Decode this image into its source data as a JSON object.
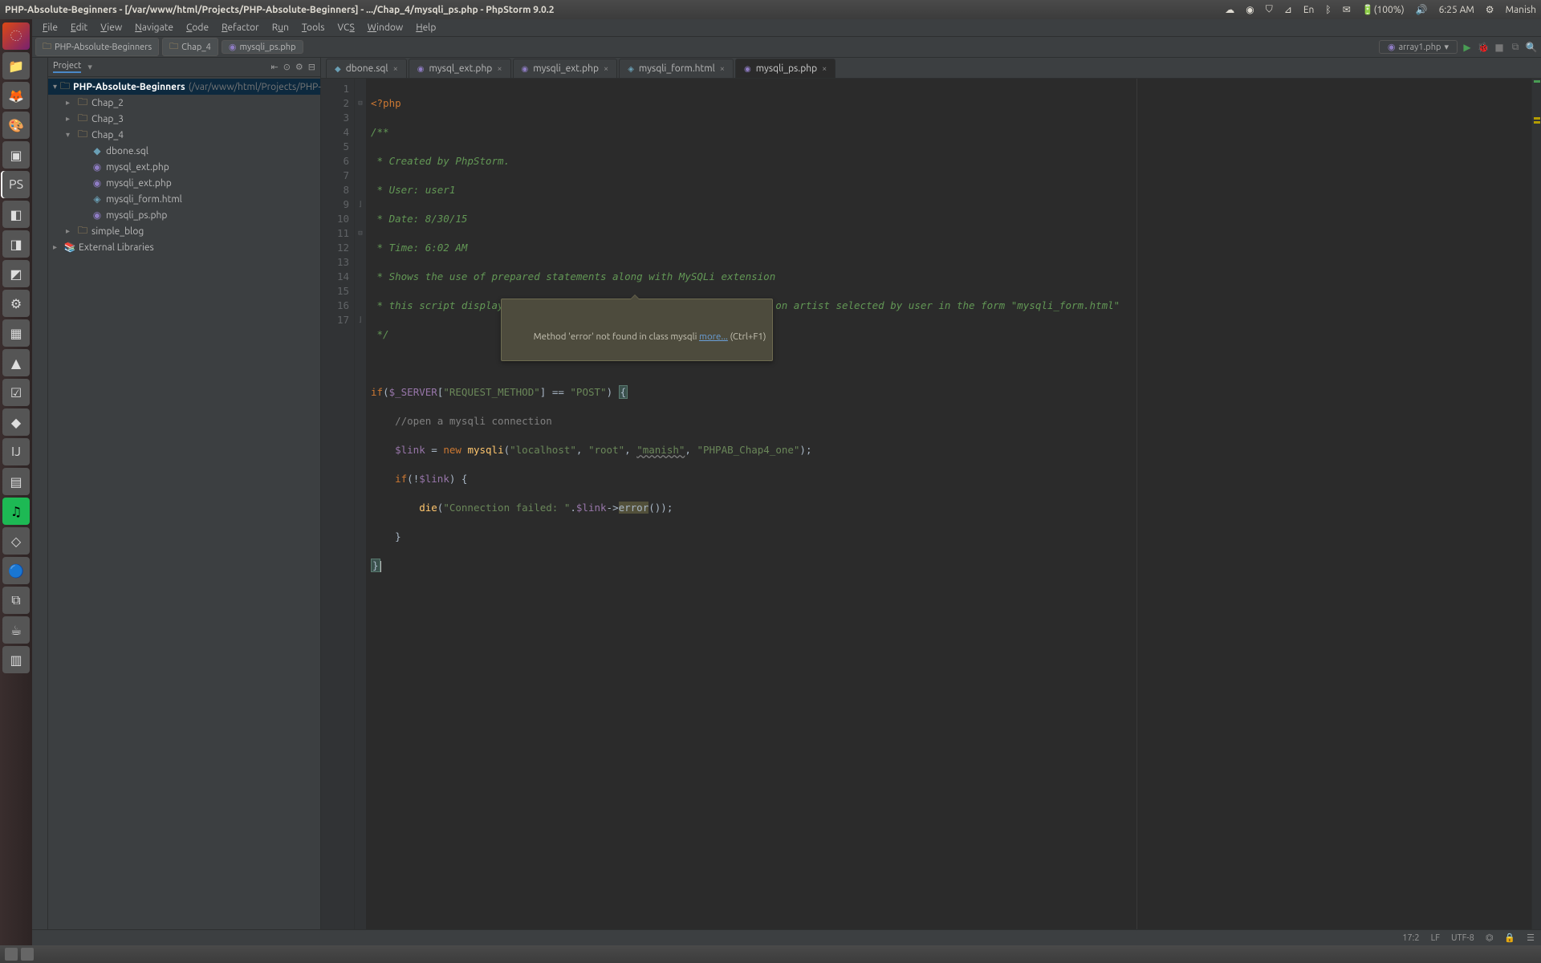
{
  "window_title": "PHP-Absolute-Beginners - [/var/www/html/Projects/PHP-Absolute-Beginners] - .../Chap_4/mysqli_ps.php - PhpStorm 9.0.2",
  "tray": {
    "battery": "(100%)",
    "volume": "🔊",
    "time": "6:25 AM",
    "user": "Manish",
    "kbd": "En",
    "mail": "✉"
  },
  "menu": [
    "File",
    "Edit",
    "View",
    "Navigate",
    "Code",
    "Refactor",
    "Run",
    "Tools",
    "VCS",
    "Window",
    "Help"
  ],
  "breadcrumbs": [
    {
      "label": "PHP-Absolute-Beginners",
      "icon": "folder"
    },
    {
      "label": "Chap_4",
      "icon": "folder"
    },
    {
      "label": "mysqli_ps.php",
      "icon": "php"
    }
  ],
  "run_config": "array1.php",
  "project_header": "Project",
  "tree": {
    "root": {
      "label": "PHP-Absolute-Beginners",
      "path": "(/var/www/html/Projects/PHP-Absolute-Beginners)"
    },
    "chap2": "Chap_2",
    "chap3": "Chap_3",
    "chap4": "Chap_4",
    "files": [
      "dbone.sql",
      "mysql_ext.php",
      "mysqli_ext.php",
      "mysqli_form.html",
      "mysqli_ps.php"
    ],
    "simple": "simple_blog",
    "ext": "External Libraries"
  },
  "tabs": [
    {
      "label": "dbone.sql",
      "icon": "sql"
    },
    {
      "label": "mysql_ext.php",
      "icon": "php"
    },
    {
      "label": "mysqli_ext.php",
      "icon": "php"
    },
    {
      "label": "mysqli_form.html",
      "icon": "html"
    },
    {
      "label": "mysqli_ps.php",
      "icon": "php",
      "active": true
    }
  ],
  "code": {
    "l1": "<?php",
    "l2": "/**",
    "l3": " * Created by PhpStorm.",
    "l4": " * User: user1",
    "l5": " * Date: 8/30/15",
    "l6": " * Time: 6:02 AM",
    "l7": " * Shows the use of prepared statements along with MySQLi extension",
    "l8": " * this script displays an album name retrieved from the db, based on artist selected by user in the form \"mysqli_form.html\"",
    "l9": " */",
    "l11_a": "if",
    "l11_b": "$_SERVER",
    "l11_c": "\"REQUEST_METHOD\"",
    "l11_d": "\"POST\"",
    "l12": "//open a mysqli connection",
    "l13_a": "$link",
    "l13_b": "new",
    "l13_c": "mysqli",
    "l13_d": "\"localhost\"",
    "l13_e": "\"root\"",
    "l13_f": "\"manish\"",
    "l13_g": "\"PHPAB_Chap4_one\"",
    "l14": "$link",
    "l15_a": "die",
    "l15_b": "\"Connection failed: \"",
    "l15_c": "$link",
    "l15_d": "error",
    "l17": "}"
  },
  "tooltip": {
    "msg": "Method 'error' not found in class mysqli ",
    "more": "more...",
    "hint": " (Ctrl+F1)"
  },
  "status": {
    "pos": "17:2",
    "le": "LF",
    "enc": "UTF-8",
    "ctx": "⏣",
    "lock": "🔒"
  }
}
